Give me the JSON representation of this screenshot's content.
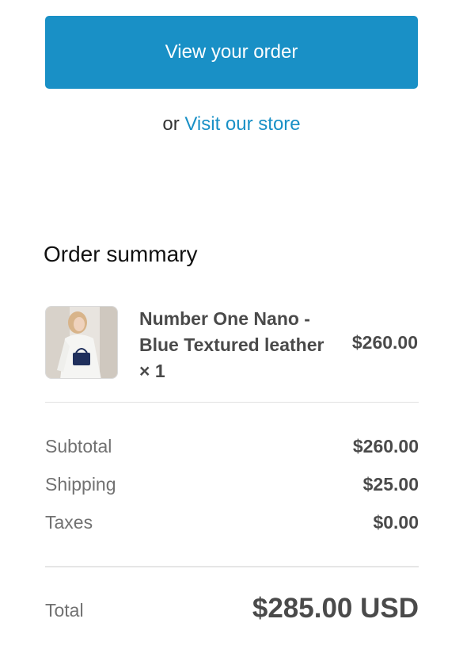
{
  "actions": {
    "view_order_label": "View your order",
    "or_text": "or",
    "visit_store_label": "Visit our store"
  },
  "summary": {
    "title": "Order summary",
    "items": [
      {
        "name": "Number One Nano - Blue Textured leather × 1",
        "price": "$260.00",
        "image": "product-photo-woman-holding-blue-handbag"
      }
    ],
    "subtotal_label": "Subtotal",
    "subtotal_value": "$260.00",
    "shipping_label": "Shipping",
    "shipping_value": "$25.00",
    "taxes_label": "Taxes",
    "taxes_value": "$0.00",
    "total_label": "Total",
    "total_value": "$285.00 USD"
  },
  "colors": {
    "accent": "#1990c6",
    "text": "#4a4a4a",
    "muted": "#717171"
  }
}
